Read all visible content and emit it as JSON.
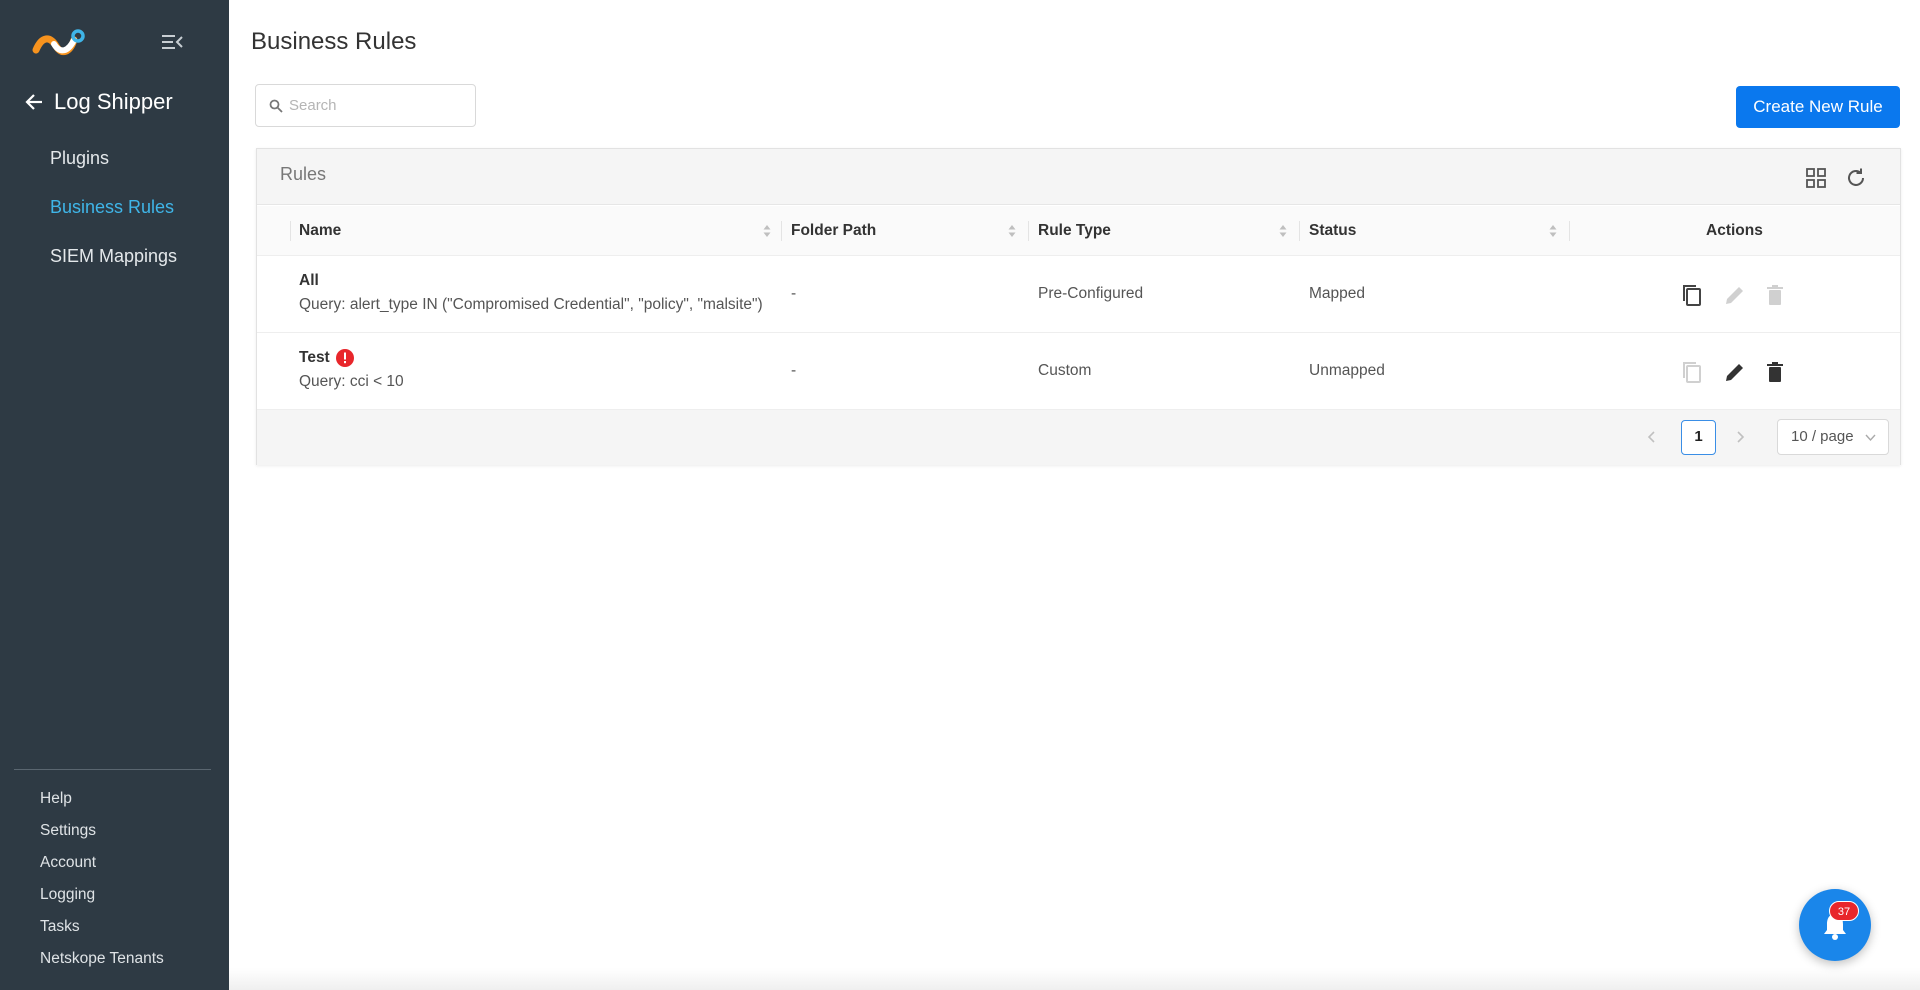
{
  "app": {
    "section_title": "Log Shipper"
  },
  "sidebar": {
    "items": [
      {
        "label": "Plugins",
        "active": false
      },
      {
        "label": "Business Rules",
        "active": true
      },
      {
        "label": "SIEM Mappings",
        "active": false
      }
    ],
    "bottom_items": [
      {
        "label": "Help"
      },
      {
        "label": "Settings"
      },
      {
        "label": "Account"
      },
      {
        "label": "Logging"
      },
      {
        "label": "Tasks"
      },
      {
        "label": "Netskope Tenants"
      }
    ]
  },
  "main": {
    "page_title": "Business Rules",
    "search_placeholder": "Search",
    "create_button": "Create New Rule",
    "card_title": "Rules",
    "columns": [
      "Name",
      "Folder Path",
      "Rule Type",
      "Status",
      "Actions"
    ],
    "rows": [
      {
        "name": "All",
        "query": "Query: alert_type IN (\"Compromised Credential\", \"policy\", \"malsite\")",
        "folder_path": "-",
        "rule_type": "Pre-Configured",
        "status": "Mapped",
        "has_error": false
      },
      {
        "name": "Test",
        "query": "Query: cci < 10",
        "folder_path": "-",
        "rule_type": "Custom",
        "status": "Unmapped",
        "has_error": true
      }
    ],
    "pagination": {
      "current_page": "1",
      "page_size": "10 / page"
    }
  },
  "notifications": {
    "count": "37"
  },
  "colors": {
    "sidebar_bg": "#2e3a44",
    "accent": "#0a78ee",
    "active_nav": "#3fb5e8",
    "error": "#e8262b"
  }
}
